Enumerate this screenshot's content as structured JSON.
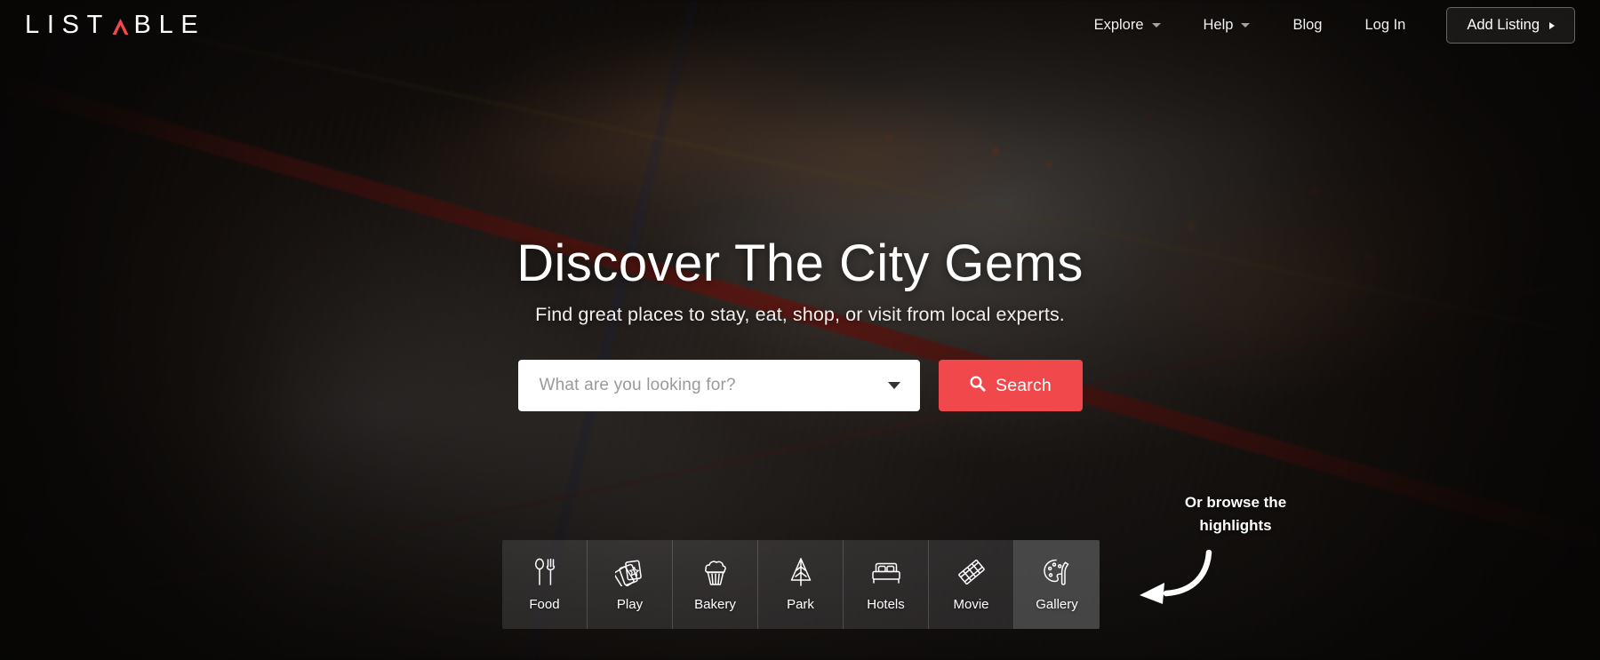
{
  "brand": {
    "name_part_1": "LIST",
    "name_part_2": "BLE",
    "accent_color": "#f1494b",
    "full_name": "LISTABLE"
  },
  "header": {
    "nav": [
      {
        "label": "Explore",
        "has_dropdown": true,
        "icon": "chevron-down-icon"
      },
      {
        "label": "Help",
        "has_dropdown": true,
        "icon": "chevron-down-icon"
      },
      {
        "label": "Blog",
        "has_dropdown": false,
        "icon": ""
      },
      {
        "label": "Log In",
        "has_dropdown": false,
        "icon": ""
      }
    ],
    "cta": {
      "label": "Add Listing",
      "icon": "caret-right-icon"
    }
  },
  "hero": {
    "headline": "Discover The City Gems",
    "subhead": "Find great places to stay, eat, shop, or visit from local experts.",
    "search": {
      "placeholder": "What are you looking for?",
      "value": "",
      "dropdown_icon": "chevron-down-icon",
      "button_label": "Search",
      "button_icon": "search-icon",
      "button_color": "#f1494b"
    }
  },
  "categories": {
    "hint_line_1": "Or browse the",
    "hint_line_2": "highlights",
    "hint_arrow_icon": "curved-arrow-left-icon",
    "items": [
      {
        "label": "Food",
        "icon": "spoon-fork-icon",
        "active": false
      },
      {
        "label": "Play",
        "icon": "cards-icon",
        "active": false
      },
      {
        "label": "Bakery",
        "icon": "cupcake-icon",
        "active": false
      },
      {
        "label": "Park",
        "icon": "tree-icon",
        "active": false
      },
      {
        "label": "Hotels",
        "icon": "bed-icon",
        "active": false
      },
      {
        "label": "Movie",
        "icon": "film-strip-icon",
        "active": false
      },
      {
        "label": "Gallery",
        "icon": "palette-icon",
        "active": true
      }
    ]
  }
}
